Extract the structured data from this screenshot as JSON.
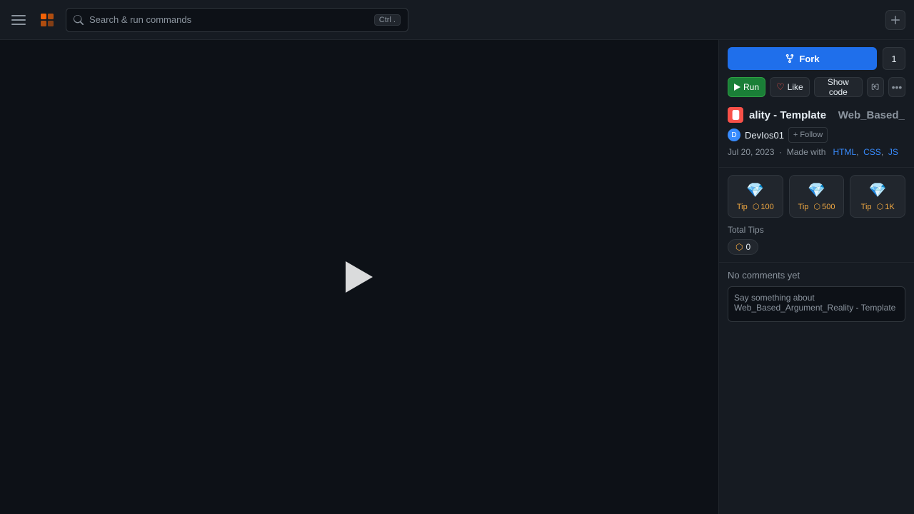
{
  "topbar": {
    "search_placeholder": "Search & run commands",
    "shortcut": "Ctrl .",
    "add_label": "+"
  },
  "sidebar": {
    "fork_label": "Fork",
    "fork_count": "1",
    "run_label": "Run",
    "like_label": "Like",
    "show_code_label": "Show code",
    "project_title": "ality - Template",
    "project_full_title": "Web_Based_Argument_Reality - Template",
    "project_tag": "Web_Based_",
    "owner_name": "DevIos01",
    "follow_label": "+ Follow",
    "date": "Jul 20, 2023",
    "made_with": "Made with",
    "tech_html": "HTML",
    "tech_css": "CSS",
    "tech_js": "JS",
    "tip_100_label": "Tip",
    "tip_100_amount": "100",
    "tip_500_label": "Tip",
    "tip_500_amount": "500",
    "tip_1k_label": "Tip",
    "tip_1k_amount": "1K",
    "total_tips_label": "Total Tips",
    "total_tips_value": "0",
    "no_comments": "No comments yet",
    "comment_placeholder": "Say something about Web_Based_Argument_Reality - Template"
  }
}
